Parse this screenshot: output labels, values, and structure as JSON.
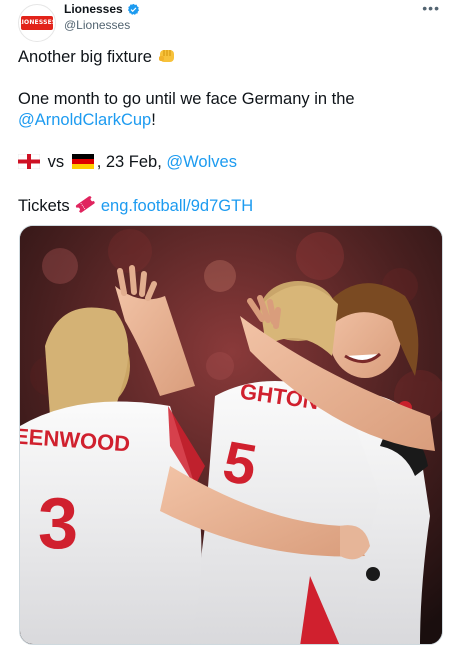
{
  "author": {
    "display_name": "Lionesses",
    "handle": "@Lionesses",
    "avatar_text": "LIONESSES",
    "verified": true
  },
  "tweet": {
    "line1": "Another big fixture",
    "line2": "One month to go until we face Germany in the",
    "line3_link": "@ArnoldClarkCup",
    "line3_suffix": "!",
    "line4_vs": "vs",
    "line4_date": ", 23 Feb, ",
    "line4_link": "@Wolves",
    "line5_prefix": "Tickets",
    "line5_link": "eng.football/9d7GTH"
  },
  "media": {
    "shirt_left_name": "EENWOOD",
    "shirt_left_number": "3",
    "shirt_right_name": "GHTON",
    "shirt_right_number": "5"
  },
  "icons": {
    "more": "more-options-icon",
    "verified": "verified-badge-icon",
    "fist": "fist-bump-emoji-icon",
    "ticket": "ticket-emoji-icon",
    "england_flag": "england-flag-icon",
    "germany_flag": "germany-flag-icon"
  },
  "colors": {
    "link": "#1d9bf0",
    "text": "#0f1419",
    "secondary": "#536471",
    "shirt_red": "#d0202e"
  }
}
